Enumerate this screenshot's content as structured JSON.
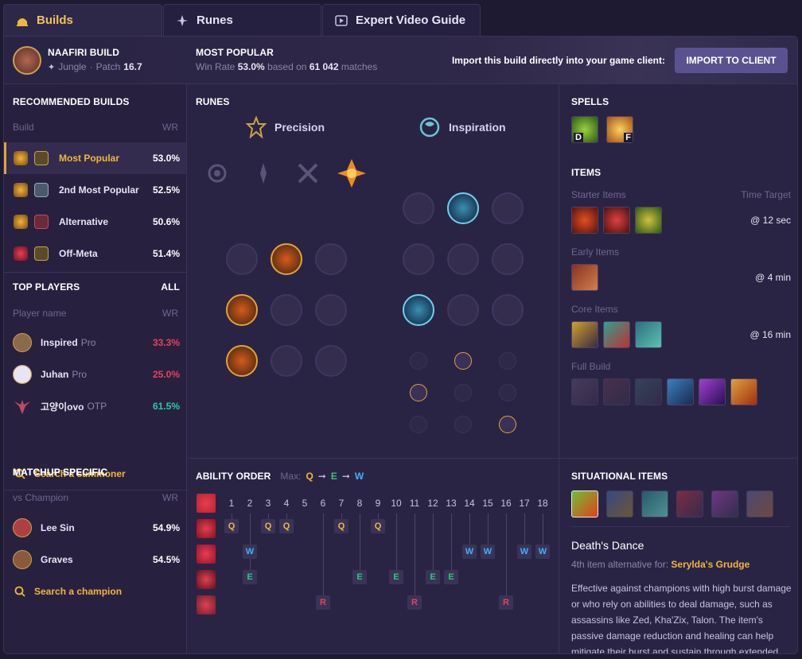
{
  "tabs": [
    {
      "label": "Builds",
      "icon": "helmet-icon"
    },
    {
      "label": "Runes",
      "icon": "runes-icon"
    },
    {
      "label": "Expert Video Guide",
      "icon": "play-icon"
    }
  ],
  "header": {
    "build_title": "NAAFIRI BUILD",
    "role": "Jungle",
    "patch_label": "Patch",
    "patch": "16.7",
    "popular_title": "MOST POPULAR",
    "win_rate_label": "Win Rate",
    "win_rate": "53.0%",
    "based_on": "based on",
    "matches": "61 042",
    "matches_label": "matches",
    "import_text": "Import this build directly into your game client:",
    "import_button": "IMPORT TO CLIENT"
  },
  "recommended": {
    "title": "RECOMMENDED BUILDS",
    "col_build": "Build",
    "col_wr": "WR",
    "items": [
      {
        "label": "Most Popular",
        "wr": "53.0%"
      },
      {
        "label": "2nd Most Popular",
        "wr": "52.5%"
      },
      {
        "label": "Alternative",
        "wr": "50.6%"
      },
      {
        "label": "Off-Meta",
        "wr": "51.4%"
      }
    ]
  },
  "top_players": {
    "title": "TOP PLAYERS",
    "all": "ALL",
    "col_name": "Player name",
    "col_wr": "WR",
    "items": [
      {
        "name": "Inspired",
        "tag": "Pro",
        "wr": "33.3%",
        "color": "#e8415a"
      },
      {
        "name": "Juhan",
        "tag": "Pro",
        "wr": "25.0%",
        "color": "#e8415a"
      },
      {
        "name": "고양이ovo",
        "tag": "OTP",
        "wr": "61.5%",
        "color": "#2fc7a7"
      }
    ],
    "search": "Search a summoner"
  },
  "matchup": {
    "title": "MATCHUP SPECIFIC",
    "col_name": "vs Champion",
    "col_wr": "WR",
    "items": [
      {
        "name": "Lee Sin",
        "wr": "54.9%"
      },
      {
        "name": "Graves",
        "wr": "54.5%"
      }
    ],
    "search": "Search a champion"
  },
  "runes": {
    "title": "RUNES",
    "primary": "Precision",
    "secondary": "Inspiration"
  },
  "ability_order": {
    "title": "ABILITY ORDER",
    "max_label": "Max:",
    "max_order": [
      "Q",
      "E",
      "W"
    ],
    "levels": [
      "1",
      "2",
      "3",
      "4",
      "5",
      "6",
      "7",
      "8",
      "9",
      "10",
      "11",
      "12",
      "13",
      "14",
      "15",
      "16",
      "17",
      "18"
    ],
    "rows": [
      {
        "key": "Q",
        "color": "#f2b53c",
        "levels": [
          1,
          3,
          4,
          7,
          9
        ]
      },
      {
        "key": "W",
        "color": "#3fb0ff",
        "levels": [
          2,
          14,
          15,
          17,
          18
        ]
      },
      {
        "key": "E",
        "color": "#2fc77a",
        "levels": [
          2,
          8,
          10,
          12,
          13
        ]
      },
      {
        "key": "R",
        "color": "#e8415a",
        "levels": [
          6,
          11,
          16
        ]
      }
    ]
  },
  "spells": {
    "title": "SPELLS",
    "keys": [
      "D",
      "F"
    ]
  },
  "items": {
    "title": "ITEMS",
    "starter_label": "Starter Items",
    "time_target_label": "Time Target",
    "starter_time": "@ 12 sec",
    "early_label": "Early Items",
    "early_time": "@ 4 min",
    "core_label": "Core Items",
    "core_time": "@ 16 min",
    "full_label": "Full Build"
  },
  "situational": {
    "title": "SITUATIONAL ITEMS",
    "item_name": "Death's Dance",
    "alt_prefix": "4th item alternative for:",
    "alt_item": "Serylda's Grudge",
    "description": "Effective against champions with high burst damage or who rely on abilities to deal damage, such as assassins like Zed, Kha'Zix, Talon. The item's passive damage reduction and healing can help mitigate their burst and sustain through extended fights."
  }
}
